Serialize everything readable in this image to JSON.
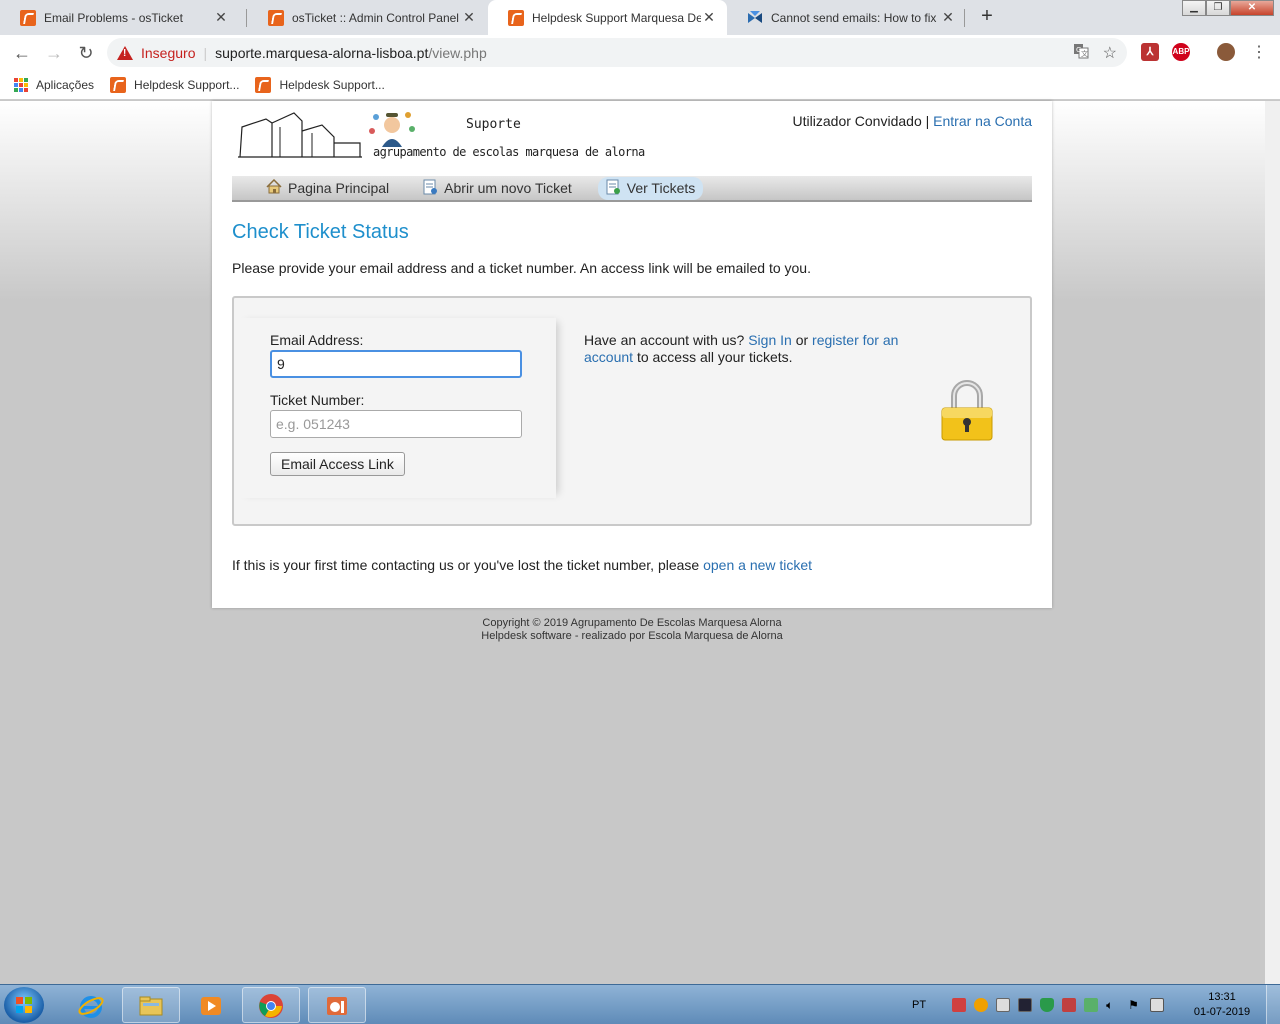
{
  "browser": {
    "tabs": [
      {
        "title": "Email Problems - osTicket",
        "favicon": "osticket-icon",
        "active": false
      },
      {
        "title": "osTicket :: Admin Control Panel",
        "favicon": "osticket-icon",
        "active": false
      },
      {
        "title": "Helpdesk Support Marquesa De",
        "favicon": "osticket-icon",
        "active": true
      },
      {
        "title": "Cannot send emails: How to fix e",
        "favicon": "blue-x-icon",
        "active": false
      }
    ],
    "new_tab": "+",
    "omnibox": {
      "security_label": "Inseguro",
      "host": "suporte.marquesa-alorna-lisboa.pt",
      "path": "/view.php"
    },
    "extensions": {
      "abp": "ABP"
    },
    "bookmarks": [
      {
        "label": "Aplicações",
        "icon": "apps-grid-icon"
      },
      {
        "label": "Helpdesk Support...",
        "icon": "osticket-icon"
      },
      {
        "label": "Helpdesk Support...",
        "icon": "osticket-icon"
      }
    ]
  },
  "site": {
    "logo": {
      "title": "Suporte",
      "subtitle": "agrupamento de escolas marquesa de alorna"
    },
    "user": {
      "guest_label": "Utilizador Convidado",
      "separator": "|",
      "login_link": "Entrar na Conta"
    },
    "nav": [
      {
        "label": "Pagina Principal",
        "icon": "home-icon",
        "active": false
      },
      {
        "label": "Abrir um novo Ticket",
        "icon": "new-ticket-icon",
        "active": false
      },
      {
        "label": "Ver Tickets",
        "icon": "view-tickets-icon",
        "active": true
      }
    ],
    "page_title": "Check Ticket Status",
    "intro": "Please provide your email address and a ticket number. An access link will be emailed to you.",
    "form": {
      "email_label": "Email Address:",
      "email_value": "9",
      "ticket_label": "Ticket Number:",
      "ticket_placeholder": "e.g. 051243",
      "submit_label": "Email Access Link"
    },
    "account": {
      "text_before": "Have an account with us?",
      "sign_in": "Sign In",
      "or": "or",
      "register": "register for an account",
      "text_after": "to access all your tickets."
    },
    "first_time": {
      "text": "If this is your first time contacting us or you've lost the ticket number, please",
      "link": "open a new ticket"
    },
    "footer": {
      "copyright": "Copyright © 2019 Agrupamento De Escolas Marquesa Alorna",
      "credit": "Helpdesk software - realizado por Escola Marquesa de Alorna"
    }
  },
  "taskbar": {
    "language": "PT",
    "time": "13:31",
    "date": "01-07-2019"
  },
  "colors": {
    "accent_blue": "#1e8fcc",
    "link_blue": "#2a6fb0",
    "osticket_orange": "#e8641c",
    "insecure_red": "#c5221f"
  }
}
